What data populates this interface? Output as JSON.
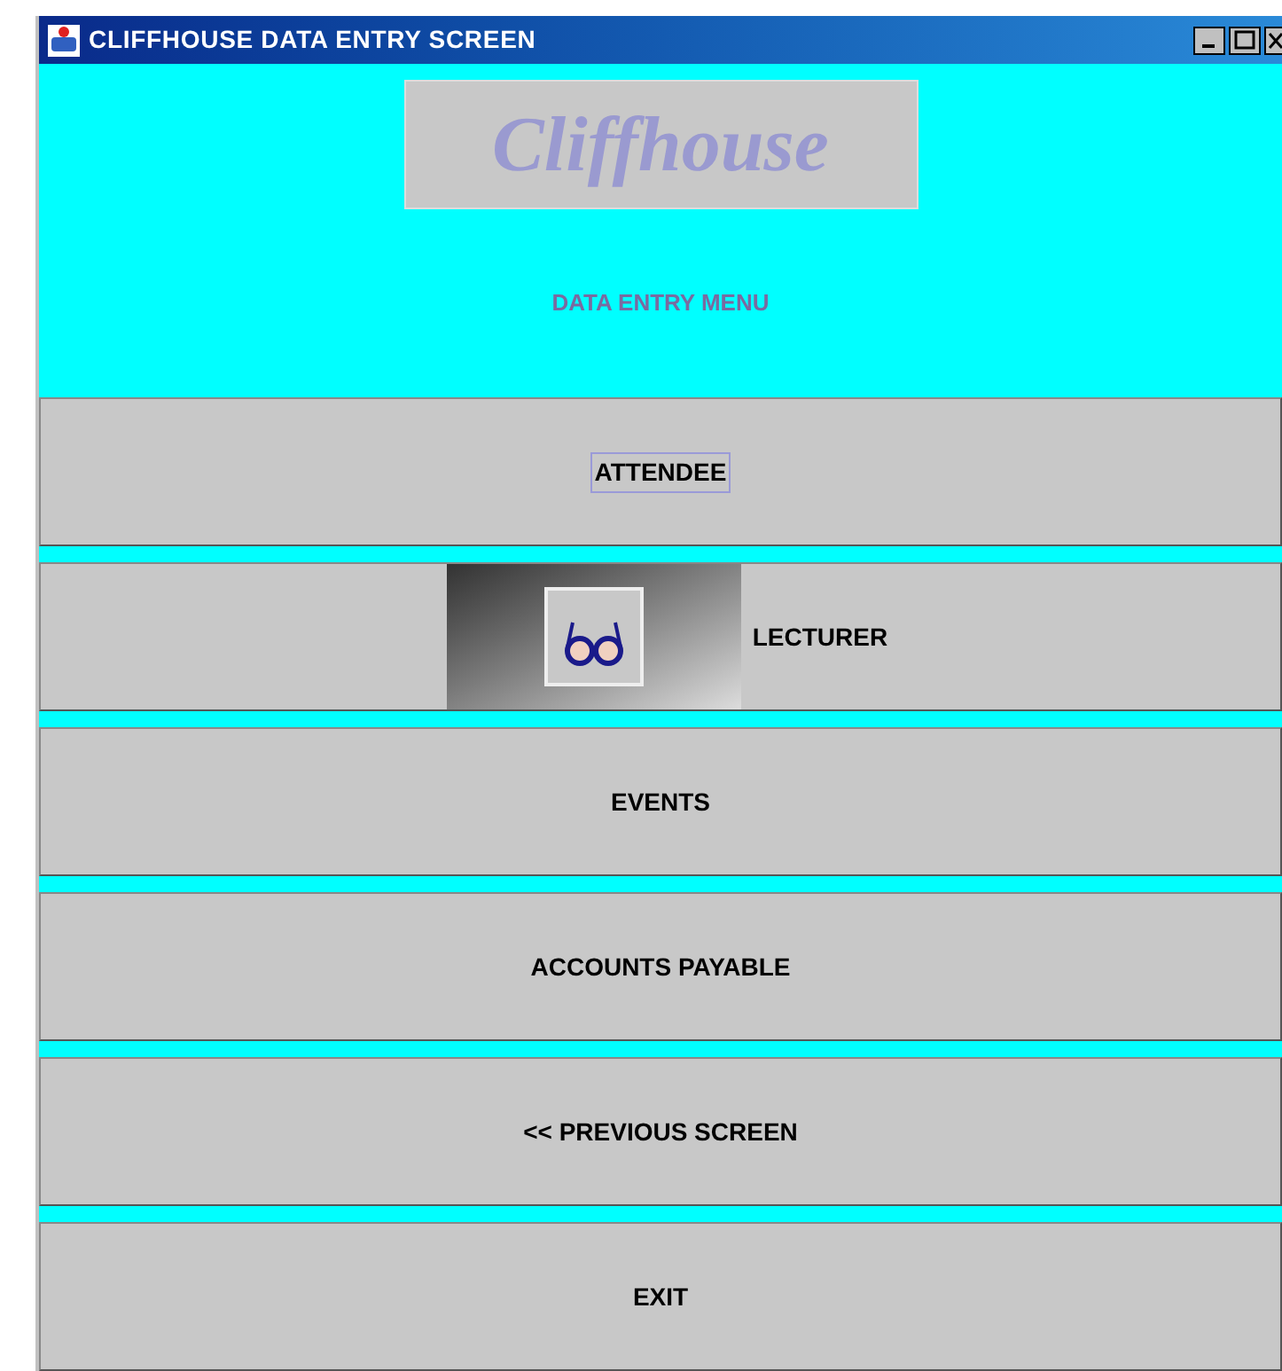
{
  "window": {
    "title": "CLIFFHOUSE DATA ENTRY SCREEN"
  },
  "logo": {
    "text": "Cliffhouse"
  },
  "heading": "DATA ENTRY MENU",
  "buttons": [
    {
      "label": "ATTENDEE",
      "kind": "text",
      "focused": true
    },
    {
      "label": "LECTURER",
      "kind": "icon",
      "focused": false
    },
    {
      "label": "EVENTS",
      "kind": "text",
      "focused": false
    },
    {
      "label": "ACCOUNTS PAYABLE",
      "kind": "text",
      "focused": false
    },
    {
      "label": "<< PREVIOUS SCREEN",
      "kind": "text",
      "focused": false
    },
    {
      "label": "EXIT",
      "kind": "text",
      "focused": false
    }
  ]
}
